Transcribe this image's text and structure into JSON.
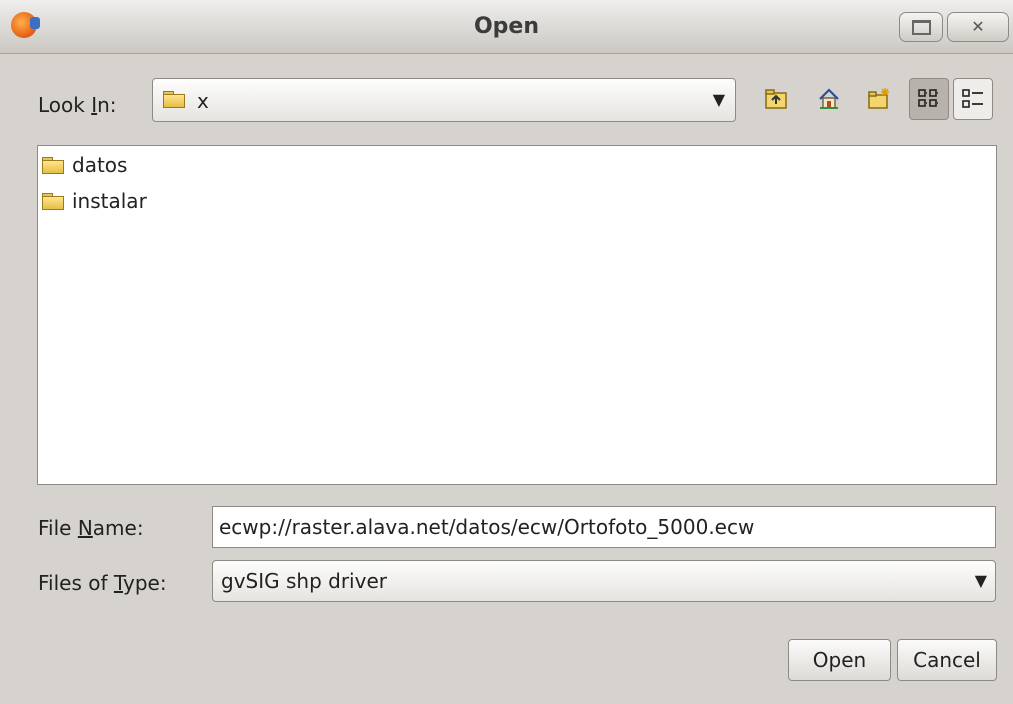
{
  "window": {
    "title": "Open",
    "close_glyph": "✕"
  },
  "lookin": {
    "label_pre": "Look ",
    "label_mnemonic": "I",
    "label_post": "n:",
    "value": "x",
    "arrow": "▼"
  },
  "toolbar": {
    "icons": [
      "up-folder-icon",
      "home-icon",
      "new-folder-icon",
      "list-view-icon",
      "details-view-icon"
    ]
  },
  "files": [
    {
      "name": "datos",
      "icon": "folder-icon"
    },
    {
      "name": "instalar",
      "icon": "folder-icon"
    }
  ],
  "filename": {
    "label_pre": "File ",
    "label_mnemonic": "N",
    "label_post": "ame:",
    "value": "ecwp://raster.alava.net/datos/ecw/Ortofoto_5000.ecw"
  },
  "filetype": {
    "label_pre": "Files of ",
    "label_mnemonic": "T",
    "label_post": "ype:",
    "value": "gvSIG shp driver",
    "arrow": "▼"
  },
  "buttons": {
    "open": "Open",
    "cancel": "Cancel"
  }
}
